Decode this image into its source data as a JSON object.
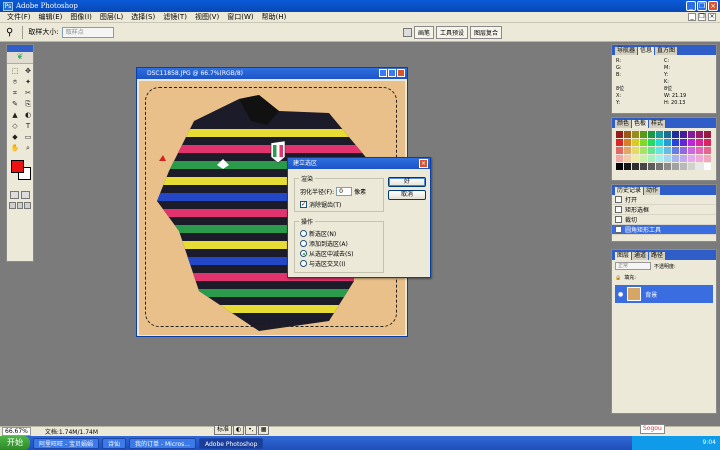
{
  "app": {
    "title": "Adobe Photoshop"
  },
  "menu": [
    "文件(F)",
    "编辑(E)",
    "图像(I)",
    "图层(L)",
    "选择(S)",
    "滤镜(T)",
    "视图(V)",
    "窗口(W)",
    "帮助(H)"
  ],
  "options": {
    "tool_icon": "magic-wand",
    "sample_size_label": "取样大小:",
    "sample_size_value": "取样点",
    "palette_tabs": [
      "画笔",
      "工具预设",
      "图层复合"
    ]
  },
  "toolbox": {
    "tools": [
      "⬚",
      "✥",
      "⌾",
      "✦",
      "⌗",
      "✂",
      "✎",
      "⎘",
      "▲",
      "◐",
      "◇",
      "T",
      "◆",
      "▭",
      "✋",
      "⌕"
    ],
    "foreground_color": "#ee1111",
    "background_color": "#ffffff"
  },
  "document": {
    "title": "DSC11858.JPG @ 66.7%(RGB/8)"
  },
  "dialog": {
    "title": "建立选区",
    "render_group": "渲染",
    "feather_label": "羽化半径(F):",
    "feather_value": "0",
    "feather_unit": "像素",
    "antialias_label": "消除锯齿(T)",
    "antialias_checked": true,
    "operation_group": "操作",
    "operations": [
      "新选区(N)",
      "添加到选区(A)",
      "从选区中减去(S)",
      "与选区交叉(I)"
    ],
    "selected_operation": 2,
    "ok_label": "好",
    "cancel_label": "取消"
  },
  "panels": {
    "navigator_tabs": [
      "导航器",
      "信息",
      "直方图"
    ],
    "info": {
      "left": [
        "R:",
        "G:",
        "B:",
        "",
        "8位",
        "X:",
        "Y:"
      ],
      "right": [
        "C:",
        "M:",
        "Y:",
        "K:",
        "8位",
        "W: 21.19",
        "H: 20.13"
      ]
    },
    "color_tabs": [
      "颜色",
      "色板",
      "样式"
    ],
    "history_tabs": [
      "历史记录",
      "动作"
    ],
    "history_items": [
      "打开",
      "矩形选框",
      "裁切",
      "圆角矩形工具"
    ],
    "layers_tabs": [
      "图层",
      "通道",
      "路径"
    ],
    "blend_mode": "正常",
    "opacity_label": "不透明度:",
    "fill_label": "填充:",
    "layer_name": "背景"
  },
  "status": {
    "zoom": "66.67%",
    "doc_size": "文档:1.74M/1.74M"
  },
  "ime": [
    "标准",
    "◐",
    "•,",
    "▦"
  ],
  "sogou": "Sogou",
  "taskbar": {
    "start_label": "开始",
    "tasks": [
      "阿里旺旺 - 宝贝娟娟",
      "诗仙",
      "我的订单 - Micros...",
      "Adobe Photoshop"
    ],
    "active_task": 3,
    "clock": "9:04"
  }
}
